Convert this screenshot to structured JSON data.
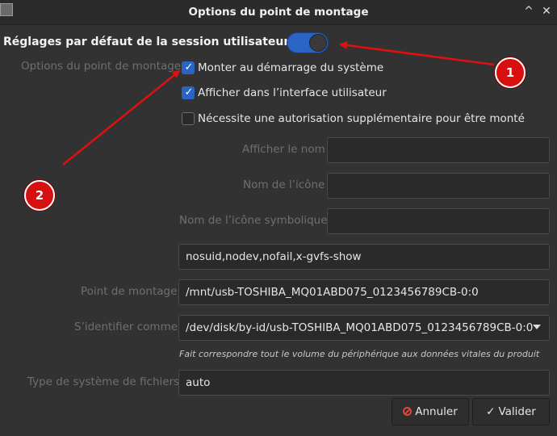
{
  "window": {
    "title": "Options du point de montage",
    "collapse_glyph": "^",
    "close_glyph": "✕"
  },
  "header": {
    "label": "Réglages par défaut de la session utilisateur",
    "toggle_state": "on"
  },
  "mount_options": {
    "section_label": "Options du point de montage",
    "checkboxes": [
      {
        "label": "Monter au démarrage du système",
        "checked": true
      },
      {
        "label": "Afficher dans l’interface utilisateur",
        "checked": true
      },
      {
        "label": "Nécessite une autorisation supplémentaire pour être monté",
        "checked": false
      }
    ]
  },
  "fields": {
    "display_name_label": "Afficher le nom",
    "display_name_value": "",
    "icon_name_label": "Nom de l’icône",
    "icon_name_value": "",
    "symbolic_icon_label": "Nom de l’icône symbolique",
    "symbolic_icon_value": "",
    "options_value": "nosuid,nodev,nofail,x-gvfs-show",
    "mount_point_label": "Point de montage",
    "mount_point_value": "/mnt/usb-TOSHIBA_MQ01ABD075_0123456789CB-0:0",
    "identify_as_label": "S’identifier comme",
    "identify_as_value": "/dev/disk/by-id/usb-TOSHIBA_MQ01ABD075_0123456789CB-0:0",
    "identify_hint": "Fait correspondre tout le volume du périphérique aux données vitales du produit",
    "fs_type_label": "Type de système de fichiers",
    "fs_type_value": "auto"
  },
  "buttons": {
    "cancel_label": "Annuler",
    "ok_label": "Valider",
    "ok_glyph": "✓"
  },
  "annotations": {
    "badge_1": "1",
    "badge_2": "2",
    "arrow_color": "#e01010"
  },
  "colors": {
    "accent": "#2a64c5",
    "background": "#323232",
    "badge": "#d80f0f"
  }
}
